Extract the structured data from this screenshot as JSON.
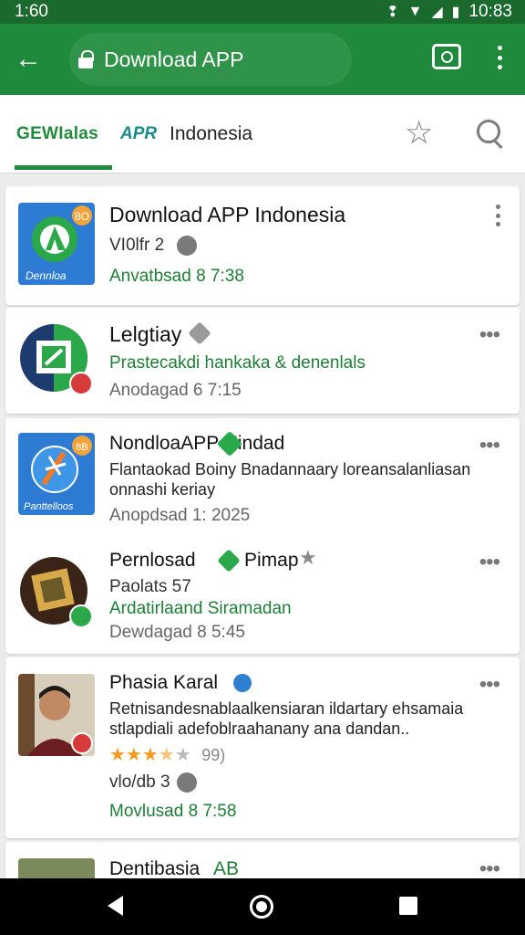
{
  "status_bar": {
    "time": "1:60",
    "clock": "10:83"
  },
  "app_bar": {
    "url": "Download APP"
  },
  "tabs": [
    {
      "label": "GEWIalas"
    },
    {
      "label": "APR"
    },
    {
      "label": "Indonesia"
    }
  ],
  "apps": [
    {
      "title": "Download APP Indonesia",
      "lines": [
        "VI0lfr 2",
        "Anvatbsad 8 7:38"
      ],
      "icon_badge": "8O",
      "icon_caption": "Dennloa"
    },
    {
      "title": "Lelgtiay",
      "lines": [
        "Prastecakdi hankaka & denenlals",
        "Anodagad 6 7:15"
      ]
    },
    {
      "title": "NondloaAPP Hindad",
      "lines": [
        "Flantaokad Boiny Bnadannaary loreansalanliasan",
        "onnashi keriay",
        "Anopdsad 1: 2025"
      ],
      "icon_badge": "8B",
      "icon_caption": "Panttelloos"
    },
    {
      "title": "Pernlosad",
      "title_suffix": "Pimap",
      "lines": [
        "Paolats 57",
        "Ardatirlaand Siramadan",
        "Dewdagad 8 5:45"
      ]
    },
    {
      "title": "Phasia Karal",
      "lines": [
        "Retnisandesnablaalkensiaran ildartary ehsamaia",
        "stlapdiali adefoblraahanany ana dandan..",
        "★★★★☆ ✱ 99)",
        "vlo/db 3",
        "Movlusad 8 7:58"
      ],
      "rating": 3.5,
      "rating_label": "99)"
    },
    {
      "title": "Dentibasia",
      "title_suffix": "AB"
    }
  ],
  "colors": {
    "status_bar": "#1a6a2e",
    "app_bar": "#1f8a3b",
    "accent_green": "#1f7e36",
    "verified_blue": "#2f7fd1",
    "star_orange": "#f59a20"
  },
  "icons": [
    "back-arrow-icon",
    "lock-icon",
    "camera-icon",
    "overflow-menu-icon",
    "star-icon",
    "search-icon",
    "more-horizontal-icon",
    "verified-icon",
    "nav-back-icon",
    "nav-home-icon",
    "nav-recent-icon"
  ]
}
